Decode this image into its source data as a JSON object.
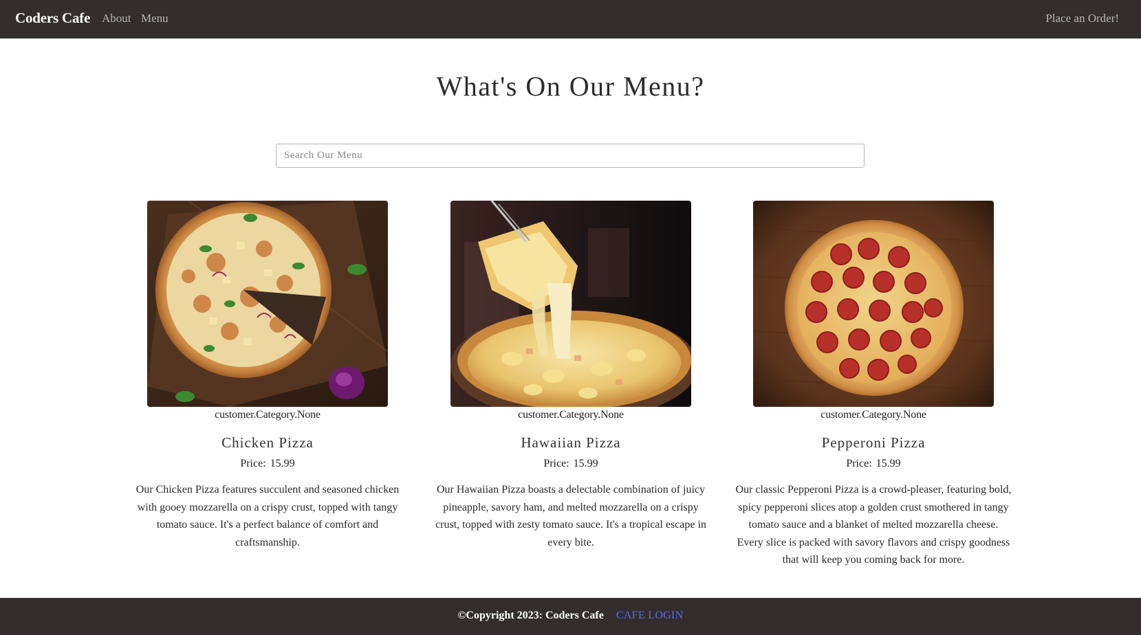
{
  "navbar": {
    "brand": "Coders Cafe",
    "links": [
      "About",
      "Menu"
    ],
    "order_link": "Place an Order!"
  },
  "main": {
    "title": "What's On Our Menu?",
    "search": {
      "placeholder": "Search Our Menu",
      "value": ""
    },
    "items": [
      {
        "category": "customer.Category.None",
        "name": "Chicken Pizza",
        "price_label": "Price:",
        "price": "15.99",
        "description": "Our Chicken Pizza features succulent and seasoned chicken with gooey mozzarella on a crispy crust, topped with tangy tomato sauce. It's a perfect balance of comfort and craftsmanship.",
        "image": "chicken-pizza-photo"
      },
      {
        "category": "customer.Category.None",
        "name": "Hawaiian Pizza",
        "price_label": "Price:",
        "price": "15.99",
        "description": "Our Hawaiian Pizza boasts a delectable combination of juicy pineapple, savory ham, and melted mozzarella on a crispy crust, topped with zesty tomato sauce. It's a tropical escape in every bite.",
        "image": "hawaiian-pizza-photo"
      },
      {
        "category": "customer.Category.None",
        "name": "Pepperoni Pizza",
        "price_label": "Price:",
        "price": "15.99",
        "description": "Our classic Pepperoni Pizza is a crowd-pleaser, featuring bold, spicy pepperoni slices atop a golden crust smothered in tangy tomato sauce and a blanket of melted mozzarella cheese. Every slice is packed with savory flavors and crispy goodness that will keep you coming back for more.",
        "image": "pepperoni-pizza-photo"
      }
    ]
  },
  "footer": {
    "copyright": "©Copyright 2023: Coders Cafe",
    "login": "CAFE LOGIN"
  },
  "colors": {
    "navbar_bg": "#332d2d",
    "footer_bg": "#332d2d",
    "link_accent": "#5a67f0",
    "nav_link": "#b9b6b6"
  }
}
